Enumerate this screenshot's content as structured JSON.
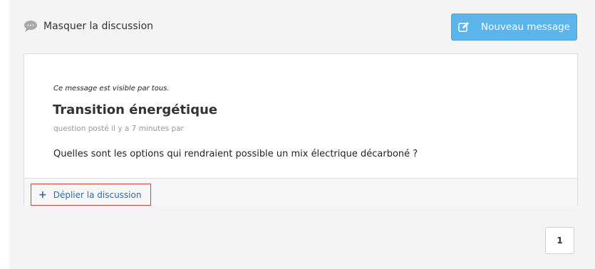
{
  "discussion": {
    "toggle_label": "Masquer la discussion",
    "toggle_icon": "speech-bubble-icon"
  },
  "toolbar": {
    "new_message_label": "Nouveau message",
    "new_message_icon": "edit-icon",
    "accent_color": "#5bb4ea"
  },
  "post": {
    "visibility": "Ce message est visible par tous.",
    "title": "Transition énergétique",
    "meta": "question posté il y a 7 minutes par",
    "body": "Quelles sont les options qui rendraient possible un mix électrique décarboné ?"
  },
  "footer": {
    "expand_label": "Déplier la discussion",
    "expand_icon": "plus-icon",
    "highlight_color": "#d9413f"
  },
  "pagination": {
    "current_page": "1"
  }
}
